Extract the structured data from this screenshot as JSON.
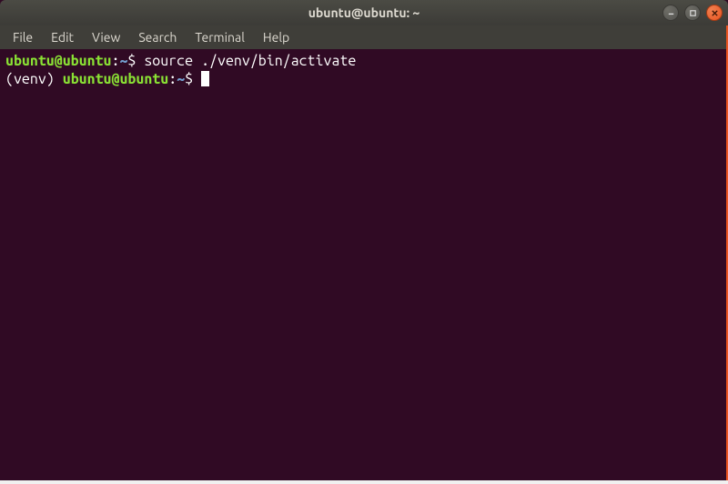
{
  "titlebar": {
    "title": "ubuntu@ubuntu: ~"
  },
  "menubar": {
    "items": [
      "File",
      "Edit",
      "View",
      "Search",
      "Terminal",
      "Help"
    ]
  },
  "terminal": {
    "line1": {
      "user_host": "ubuntu@ubuntu",
      "colon": ":",
      "path": "~",
      "dollar": "$ ",
      "command": "source ./venv/bin/activate"
    },
    "line2": {
      "venv_prefix": "(venv) ",
      "user_host": "ubuntu@ubuntu",
      "colon": ":",
      "path": "~",
      "dollar": "$ "
    }
  }
}
